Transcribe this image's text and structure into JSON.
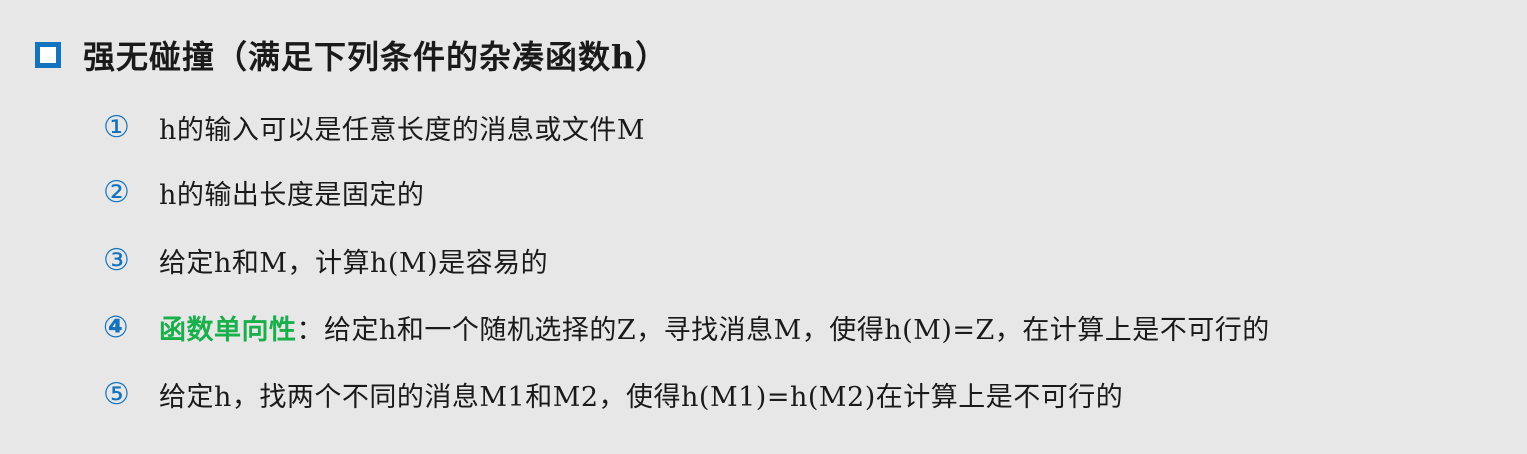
{
  "heading": {
    "text": "强无碰撞（满足下列条件的杂凑函数h）"
  },
  "items": [
    {
      "num": "①",
      "text": "h的输入可以是任意长度的消息或文件M"
    },
    {
      "num": "②",
      "text": "h的输出长度是固定的"
    },
    {
      "num": "③",
      "text": "给定h和M，计算h(M)是容易的"
    },
    {
      "num": "④",
      "highlight": "函数单向性",
      "text": "：给定h和一个随机选择的Z，寻找消息M，使得h(M)=Z，在计算上是不可行的"
    },
    {
      "num": "⑤",
      "text": "给定h，找两个不同的消息M1和M2，使得h(M1)=h(M2)在计算上是不可行的"
    }
  ],
  "colors": {
    "bullet": "#1473bf",
    "number": "#1473bf",
    "highlight": "#19b04b",
    "background": "#e7e7e7"
  }
}
